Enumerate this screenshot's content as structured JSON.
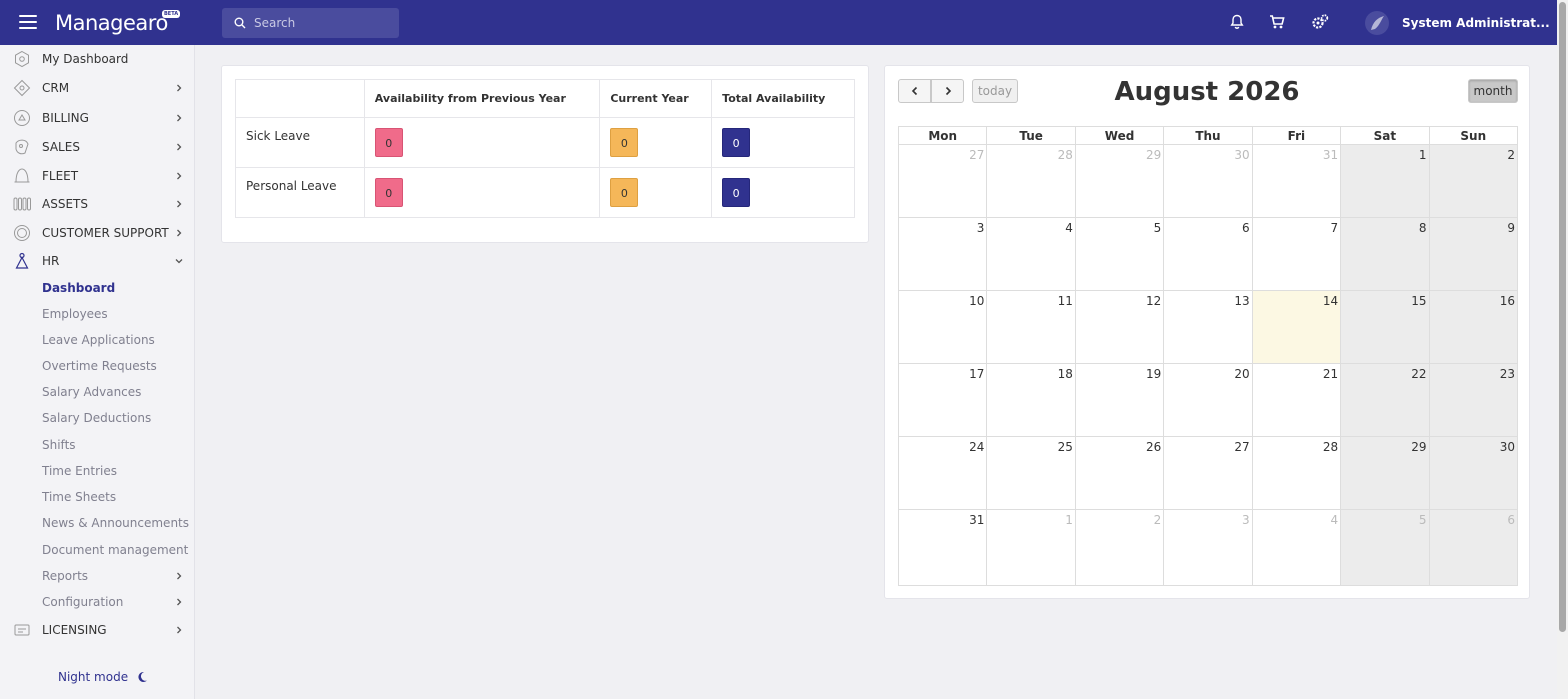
{
  "topbar": {
    "logo_text": "Managearo",
    "beta_label": "BETA",
    "search_placeholder": "Search",
    "username": "System Administrat..."
  },
  "sidebar": {
    "items": [
      {
        "label": "My Dashboard",
        "icon": "dashboard-icon"
      },
      {
        "label": "CRM",
        "icon": "crm-icon"
      },
      {
        "label": "BILLING",
        "icon": "billing-icon"
      },
      {
        "label": "SALES",
        "icon": "sales-icon"
      },
      {
        "label": "FLEET",
        "icon": "fleet-icon"
      },
      {
        "label": "ASSETS",
        "icon": "assets-icon"
      },
      {
        "label": "CUSTOMER SUPPORT",
        "icon": "support-icon"
      },
      {
        "label": "HR",
        "icon": "hr-icon"
      }
    ],
    "hr_subitems": [
      {
        "label": "Dashboard",
        "active": true
      },
      {
        "label": "Employees"
      },
      {
        "label": "Leave Applications"
      },
      {
        "label": "Overtime Requests"
      },
      {
        "label": "Salary Advances"
      },
      {
        "label": "Salary Deductions"
      },
      {
        "label": "Shifts"
      },
      {
        "label": "Time Entries"
      },
      {
        "label": "Time Sheets"
      },
      {
        "label": "News & Announcements"
      },
      {
        "label": "Document management"
      },
      {
        "label": "Reports"
      },
      {
        "label": "Configuration"
      }
    ],
    "licensing_label": "LICENSING",
    "night_mode_label": "Night mode"
  },
  "leave_table": {
    "headers": [
      "",
      "Availability from Previous Year",
      "Current Year",
      "Total Availability"
    ],
    "rows": [
      {
        "type": "Sick Leave",
        "previous": "0",
        "current": "0",
        "total": "0"
      },
      {
        "type": "Personal Leave",
        "previous": "0",
        "current": "0",
        "total": "0"
      }
    ]
  },
  "calendar": {
    "title": "August 2026",
    "today_label": "today",
    "month_label": "month",
    "weekdays": [
      "Mon",
      "Tue",
      "Wed",
      "Thu",
      "Fri",
      "Sat",
      "Sun"
    ],
    "today_date": "14",
    "weeks": [
      [
        "27",
        "28",
        "29",
        "30",
        "31",
        "1",
        "2"
      ],
      [
        "3",
        "4",
        "5",
        "6",
        "7",
        "8",
        "9"
      ],
      [
        "10",
        "11",
        "12",
        "13",
        "14",
        "15",
        "16"
      ],
      [
        "17",
        "18",
        "19",
        "20",
        "21",
        "22",
        "23"
      ],
      [
        "24",
        "25",
        "26",
        "27",
        "28",
        "29",
        "30"
      ],
      [
        "31",
        "1",
        "2",
        "3",
        "4",
        "5",
        "6"
      ]
    ]
  },
  "colors": {
    "brand": "#30328f",
    "pink_badge": "#f06b8a",
    "yellow_badge": "#f5b759",
    "today_highlight": "#fcf8e3"
  }
}
